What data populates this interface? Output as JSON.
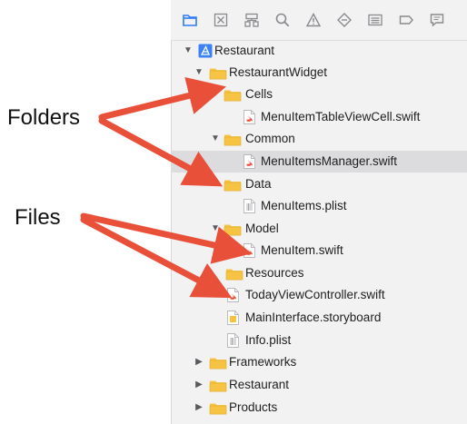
{
  "toolbar": {
    "icons": [
      "folder-icon",
      "source-control-icon",
      "hierarchy-icon",
      "search-icon",
      "warning-icon",
      "test-icon",
      "debug-icon",
      "breakpoint-icon",
      "report-icon"
    ]
  },
  "tree": [
    {
      "label": "Restaurant",
      "kind": "project",
      "disclosure": "open"
    },
    {
      "label": "RestaurantWidget",
      "kind": "folder",
      "disclosure": "open"
    },
    {
      "label": "Cells",
      "kind": "folder",
      "disclosure": "open"
    },
    {
      "label": "MenuItemTableViewCell.swift",
      "kind": "swift"
    },
    {
      "label": "Common",
      "kind": "folder",
      "disclosure": "open"
    },
    {
      "label": "MenuItemsManager.swift",
      "kind": "swift",
      "selected": true
    },
    {
      "label": "Data",
      "kind": "folder",
      "disclosure": "open"
    },
    {
      "label": "MenuItems.plist",
      "kind": "plist"
    },
    {
      "label": "Model",
      "kind": "folder",
      "disclosure": "open"
    },
    {
      "label": "MenuItem.swift",
      "kind": "swift"
    },
    {
      "label": "Resources",
      "kind": "folder",
      "disclosure": "none"
    },
    {
      "label": "TodayViewController.swift",
      "kind": "swift"
    },
    {
      "label": "MainInterface.storyboard",
      "kind": "storyboard"
    },
    {
      "label": "Info.plist",
      "kind": "plist"
    },
    {
      "label": "Frameworks",
      "kind": "folder",
      "disclosure": "closed"
    },
    {
      "label": "Restaurant",
      "kind": "folder",
      "disclosure": "closed"
    },
    {
      "label": "Products",
      "kind": "folder",
      "disclosure": "closed"
    }
  ],
  "annotations": {
    "folders": "Folders",
    "files": "Files"
  },
  "colors": {
    "folder": "#f6c343",
    "arrow": "#e8503a",
    "swift": "#e8503a",
    "selected": "#dcdcde"
  }
}
